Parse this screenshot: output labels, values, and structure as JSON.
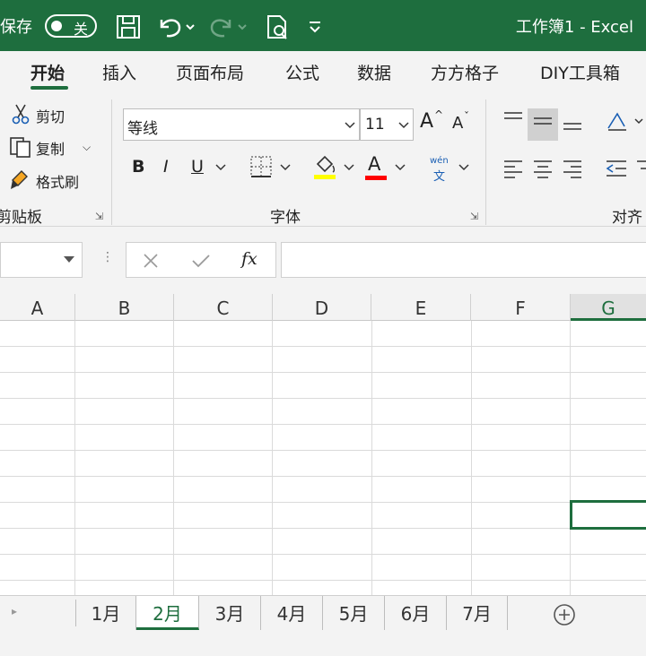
{
  "titlebar": {
    "autosave_label": "保存",
    "toggle_state": "关",
    "title": "工作簿1 - Excel"
  },
  "tabs": [
    {
      "label": "开始"
    },
    {
      "label": "插入"
    },
    {
      "label": "页面布局"
    },
    {
      "label": "公式"
    },
    {
      "label": "数据"
    },
    {
      "label": "方方格子"
    },
    {
      "label": "DIY工具箱"
    }
  ],
  "ribbon": {
    "clipboard": {
      "cut": "剪切",
      "copy": "复制",
      "format_painter": "格式刷",
      "group": "剪贴板"
    },
    "font": {
      "name": "等线",
      "size": "11",
      "bold": "B",
      "italic": "I",
      "underline": "U",
      "font_color_glyph": "A",
      "grow_glyph": "A",
      "shrink_glyph": "A",
      "phonetic_top": "wén",
      "phonetic_bottom": "文",
      "group": "字体",
      "fill_color": "#ffff00",
      "font_color": "#ff0000"
    },
    "align": {
      "group": "对齐"
    }
  },
  "formula_bar": {
    "fx": "fx"
  },
  "columns": [
    "A",
    "B",
    "C",
    "D",
    "E",
    "F",
    "G"
  ],
  "sheets": [
    "1月",
    "2月",
    "3月",
    "4月",
    "5月",
    "6月",
    "7月"
  ],
  "colors": {
    "accent": "#1e6e3e"
  }
}
